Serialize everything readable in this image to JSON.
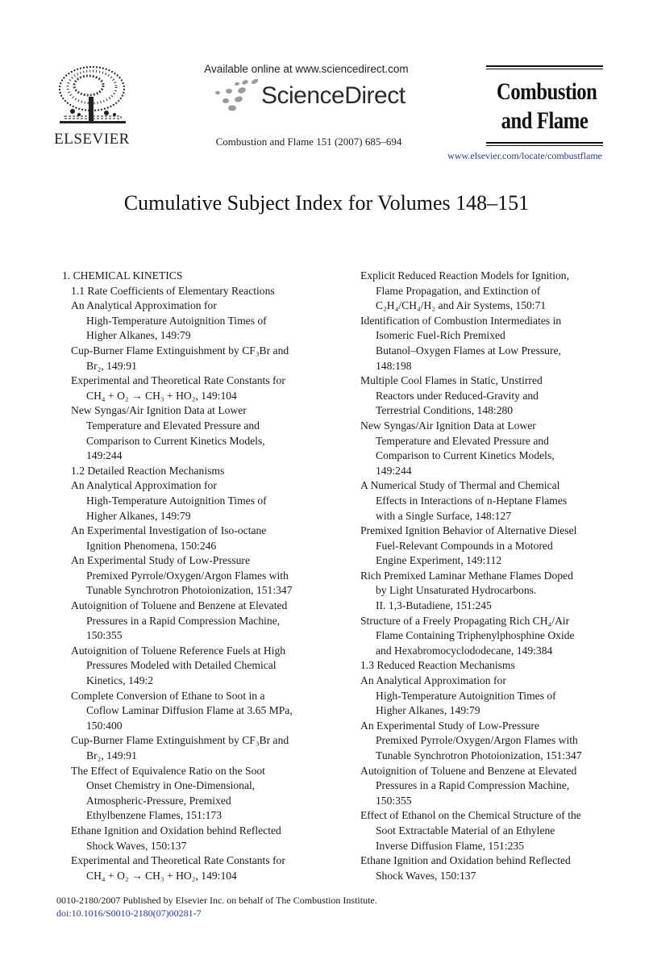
{
  "header": {
    "publisher_logo_wordmark": "ELSEVIER",
    "available_online": "Available online at www.sciencedirect.com",
    "sciencedirect_brand": "ScienceDirect",
    "journal_reference": "Combustion and Flame 151 (2007) 685–694",
    "journal_title_line1": "Combustion",
    "journal_title_line2": "and Flame",
    "journal_url": "www.elsevier.com/locate/combustflame",
    "brand_link_color": "#2a3b8f"
  },
  "page_title": "Cumulative Subject Index for Volumes 148–151",
  "left_column": [
    {
      "type": "section",
      "lines": [
        "1. CHEMICAL KINETICS"
      ]
    },
    {
      "type": "subsection",
      "lines": [
        "1.1 Rate Coefficients of Elementary Reactions"
      ]
    },
    {
      "type": "entry",
      "lines": [
        "An Analytical Approximation for",
        "High-Temperature Autoignition Times of",
        "Higher Alkanes, 149:79"
      ]
    },
    {
      "type": "entry",
      "lines": [
        "Cup-Burner Flame Extinguishment by CF₃Br and",
        "Br₂, 149:91"
      ]
    },
    {
      "type": "entry",
      "lines": [
        "Experimental and Theoretical Rate Constants for",
        "CH₄ + O₂ → CH₃ + HO₂, 149:104"
      ]
    },
    {
      "type": "entry",
      "lines": [
        "New Syngas/Air Ignition Data at Lower",
        "Temperature and Elevated Pressure and",
        "Comparison to Current Kinetics Models,",
        "149:244"
      ]
    },
    {
      "type": "subsection",
      "lines": [
        "1.2 Detailed Reaction Mechanisms"
      ]
    },
    {
      "type": "entry",
      "lines": [
        "An Analytical Approximation for",
        "High-Temperature Autoignition Times of",
        "Higher Alkanes, 149:79"
      ]
    },
    {
      "type": "entry",
      "lines": [
        "An Experimental Investigation of Iso-octane",
        "Ignition Phenomena, 150:246"
      ]
    },
    {
      "type": "entry",
      "lines": [
        "An Experimental Study of Low-Pressure",
        "Premixed Pyrrole/Oxygen/Argon Flames with",
        "Tunable Synchrotron Photoionization, 151:347"
      ]
    },
    {
      "type": "entry",
      "lines": [
        "Autoignition of Toluene and Benzene at Elevated",
        "Pressures in a Rapid Compression Machine,",
        "150:355"
      ]
    },
    {
      "type": "entry",
      "lines": [
        "Autoignition of Toluene Reference Fuels at High",
        "Pressures Modeled with Detailed Chemical",
        "Kinetics, 149:2"
      ]
    },
    {
      "type": "entry",
      "lines": [
        "Complete Conversion of Ethane to Soot in a",
        "Coflow Laminar Diffusion Flame at 3.65 MPa,",
        "150:400"
      ]
    },
    {
      "type": "entry",
      "lines": [
        "Cup-Burner Flame Extinguishment by CF₃Br and",
        "Br₂, 149:91"
      ]
    },
    {
      "type": "entry",
      "lines": [
        "The Effect of Equivalence Ratio on the Soot",
        "Onset Chemistry in One-Dimensional,",
        "Atmospheric-Pressure, Premixed",
        "Ethylbenzene Flames, 151:173"
      ]
    },
    {
      "type": "entry",
      "lines": [
        "Ethane Ignition and Oxidation behind Reflected",
        "Shock Waves, 150:137"
      ]
    },
    {
      "type": "entry",
      "lines": [
        "Experimental and Theoretical Rate Constants for",
        "CH₄ + O₂ → CH₃ + HO₂, 149:104"
      ]
    }
  ],
  "right_column": [
    {
      "type": "entry",
      "lines": [
        "Explicit Reduced Reaction Models for Ignition,",
        "Flame Propagation, and Extinction of",
        "C₂H₄/CH₄/H₂ and Air Systems, 150:71"
      ]
    },
    {
      "type": "entry",
      "lines": [
        "Identification of Combustion Intermediates in",
        "Isomeric Fuel-Rich Premixed",
        "Butanol–Oxygen Flames at Low Pressure,",
        "148:198"
      ]
    },
    {
      "type": "entry",
      "lines": [
        "Multiple Cool Flames in Static, Unstirred",
        "Reactors under Reduced-Gravity and",
        "Terrestrial Conditions, 148:280"
      ]
    },
    {
      "type": "entry",
      "lines": [
        "New Syngas/Air Ignition Data at Lower",
        "Temperature and Elevated Pressure and",
        "Comparison to Current Kinetics Models,",
        "149:244"
      ]
    },
    {
      "type": "entry",
      "lines": [
        "A Numerical Study of Thermal and Chemical",
        "Effects in Interactions of n-Heptane Flames",
        "with a Single Surface, 148:127"
      ]
    },
    {
      "type": "entry",
      "lines": [
        "Premixed Ignition Behavior of Alternative Diesel",
        "Fuel-Relevant Compounds in a Motored",
        "Engine Experiment, 149:112"
      ]
    },
    {
      "type": "entry",
      "lines": [
        "Rich Premixed Laminar Methane Flames Doped",
        "by Light Unsaturated Hydrocarbons.",
        "II. 1,3-Butadiene, 151:245"
      ]
    },
    {
      "type": "entry",
      "lines": [
        "Structure of a Freely Propagating Rich CH₄/Air",
        "Flame Containing Triphenylphosphine Oxide",
        "and Hexabromocyclododecane, 149:384"
      ]
    },
    {
      "type": "subsection",
      "lines": [
        "1.3 Reduced Reaction Mechanisms"
      ]
    },
    {
      "type": "entry",
      "lines": [
        "An Analytical Approximation for",
        "High-Temperature Autoignition Times of",
        "Higher Alkanes, 149:79"
      ]
    },
    {
      "type": "entry",
      "lines": [
        "An Experimental Study of Low-Pressure",
        "Premixed Pyrrole/Oxygen/Argon Flames with",
        "Tunable Synchrotron Photoionization, 151:347"
      ]
    },
    {
      "type": "entry",
      "lines": [
        "Autoignition of Toluene and Benzene at Elevated",
        "Pressures in a Rapid Compression Machine,",
        "150:355"
      ]
    },
    {
      "type": "entry",
      "lines": [
        "Effect of Ethanol on the Chemical Structure of the",
        "Soot Extractable Material of an Ethylene",
        "Inverse Diffusion Flame, 151:235"
      ]
    },
    {
      "type": "entry",
      "lines": [
        "Ethane Ignition and Oxidation behind Reflected",
        "Shock Waves, 150:137"
      ]
    }
  ],
  "footer": {
    "copyright": "0010-2180/2007 Published by Elsevier Inc. on behalf of The Combustion Institute.",
    "doi": "doi:10.1016/S0010-2180(07)00281-7"
  }
}
